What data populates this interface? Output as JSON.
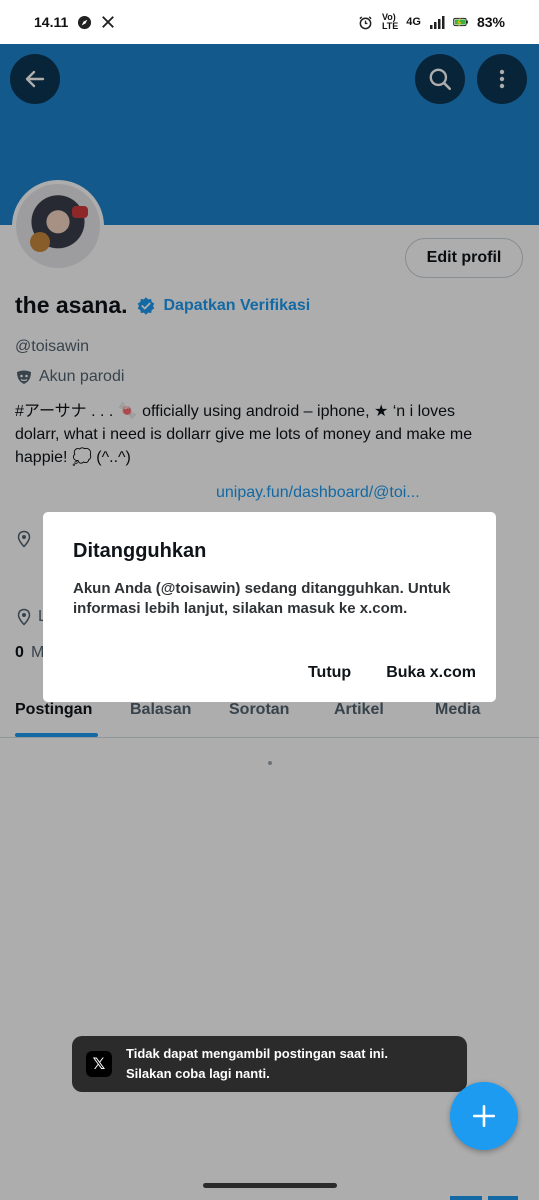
{
  "status_bar": {
    "time": "14.11",
    "network_4g": "4G",
    "volte_top": "Vo)",
    "volte_bottom": "LTE",
    "battery": "83%"
  },
  "profile": {
    "name": "the asana.",
    "verify_label": "Dapatkan Verifikasi",
    "handle": "@toisawin",
    "parody_label": "Akun parodi",
    "bio_line1": "#アーサナ . . . 🍬 officially using android – iphone, ★ ‘n i loves",
    "bio_line2": "dolarr, what i need is dollarr give me lots of money and make me",
    "bio_line3": "happie! 💭 (^..^)",
    "link": "unipay.fun/dashboard/@toi...",
    "edit_button": "Edit profil",
    "peek_l": "L",
    "peek_count": "0",
    "peek_m": "M"
  },
  "tabs": [
    {
      "label": "Postingan",
      "active": true
    },
    {
      "label": "Balasan"
    },
    {
      "label": "Sorotan"
    },
    {
      "label": "Artikel"
    },
    {
      "label": "Media"
    }
  ],
  "dialog": {
    "title": "Ditangguhkan",
    "body": "Akun Anda (@toisawin) sedang ditangguhkan. Untuk informasi lebih lanjut, silakan masuk ke x.com.",
    "close_button": "Tutup",
    "open_button": "Buka x.com"
  },
  "toast": {
    "line1": "Tidak dapat mengambil postingan saat ini.",
    "line2": "Silakan coba lagi nanti.",
    "logo": "𝕏"
  },
  "colors": {
    "banner": "#1d84cf",
    "accent": "#1d9bf0",
    "scrim": "rgba(0,0,0,0.32)"
  },
  "icons": [
    "back-arrow-icon",
    "search-icon",
    "more-vertical-icon",
    "verified-badge-icon",
    "parody-mask-icon",
    "location-pin-icon",
    "compose-plus-icon",
    "x-logo-icon"
  ]
}
